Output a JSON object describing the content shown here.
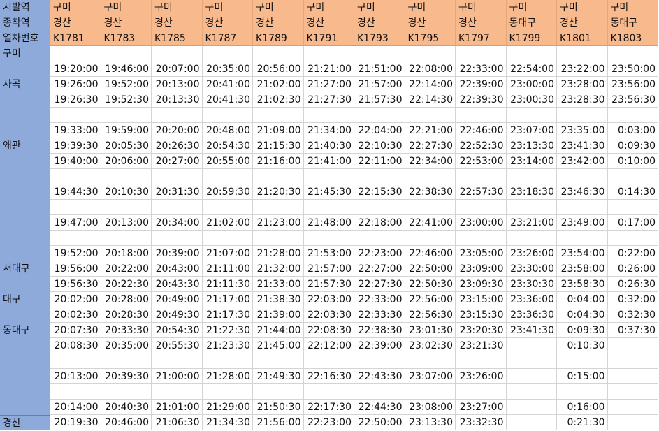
{
  "header": {
    "row_labels": [
      "시발역",
      "종착역",
      "열차번호"
    ],
    "trains": [
      {
        "origin": "구미",
        "dest": "경산",
        "no": "K1781"
      },
      {
        "origin": "구미",
        "dest": "경산",
        "no": "K1783"
      },
      {
        "origin": "구미",
        "dest": "경산",
        "no": "K1785"
      },
      {
        "origin": "구미",
        "dest": "경산",
        "no": "K1787"
      },
      {
        "origin": "구미",
        "dest": "경산",
        "no": "K1789"
      },
      {
        "origin": "구미",
        "dest": "경산",
        "no": "K1791"
      },
      {
        "origin": "구미",
        "dest": "경산",
        "no": "K1793"
      },
      {
        "origin": "구미",
        "dest": "경산",
        "no": "K1795"
      },
      {
        "origin": "구미",
        "dest": "경산",
        "no": "K1797"
      },
      {
        "origin": "구미",
        "dest": "동대구",
        "no": "K1799"
      },
      {
        "origin": "구미",
        "dest": "경산",
        "no": "K1801"
      },
      {
        "origin": "구미",
        "dest": "동대구",
        "no": "K1803"
      }
    ]
  },
  "rows": [
    {
      "label": "구미",
      "times": [
        "",
        "",
        "",
        "",
        "",
        "",
        "",
        "",
        "",
        "",
        "",
        ""
      ]
    },
    {
      "label": "",
      "times": [
        "19:20:00",
        "19:46:00",
        "20:07:00",
        "20:35:00",
        "20:56:00",
        "21:21:00",
        "21:51:00",
        "22:08:00",
        "22:33:00",
        "22:54:00",
        "23:22:00",
        "23:50:00"
      ]
    },
    {
      "label": "사곡",
      "times": [
        "19:26:00",
        "19:52:00",
        "20:13:00",
        "20:41:00",
        "21:02:00",
        "21:27:00",
        "21:57:00",
        "22:14:00",
        "22:39:00",
        "23:00:00",
        "23:28:00",
        "23:56:00"
      ]
    },
    {
      "label": "",
      "times": [
        "19:26:30",
        "19:52:30",
        "20:13:30",
        "20:41:30",
        "21:02:30",
        "21:27:30",
        "21:57:30",
        "22:14:30",
        "22:39:30",
        "23:00:30",
        "23:28:30",
        "23:56:30"
      ]
    },
    {
      "label": "",
      "times": [
        "",
        "",
        "",
        "",
        "",
        "",
        "",
        "",
        "",
        "",
        "",
        ""
      ]
    },
    {
      "label": "",
      "times": [
        "19:33:00",
        "19:59:00",
        "20:20:00",
        "20:48:00",
        "21:09:00",
        "21:34:00",
        "22:04:00",
        "22:21:00",
        "22:46:00",
        "23:07:00",
        "23:35:00",
        "0:03:00"
      ]
    },
    {
      "label": "왜관",
      "times": [
        "19:39:30",
        "20:05:30",
        "20:26:30",
        "20:54:30",
        "21:15:30",
        "21:40:30",
        "22:10:30",
        "22:27:30",
        "22:52:30",
        "23:13:30",
        "23:41:30",
        "0:09:30"
      ]
    },
    {
      "label": "",
      "times": [
        "19:40:00",
        "20:06:00",
        "20:27:00",
        "20:55:00",
        "21:16:00",
        "21:41:00",
        "22:11:00",
        "22:34:00",
        "22:53:00",
        "23:14:00",
        "23:42:00",
        "0:10:00"
      ]
    },
    {
      "label": "",
      "times": [
        "",
        "",
        "",
        "",
        "",
        "",
        "",
        "",
        "",
        "",
        "",
        ""
      ]
    },
    {
      "label": "",
      "times": [
        "19:44:30",
        "20:10:30",
        "20:31:30",
        "20:59:30",
        "21:20:30",
        "21:45:30",
        "22:15:30",
        "22:38:30",
        "22:57:30",
        "23:18:30",
        "23:46:30",
        "0:14:30"
      ]
    },
    {
      "label": "",
      "times": [
        "",
        "",
        "",
        "",
        "",
        "",
        "",
        "",
        "",
        "",
        "",
        ""
      ]
    },
    {
      "label": "",
      "times": [
        "19:47:00",
        "20:13:00",
        "20:34:00",
        "21:02:00",
        "21:23:00",
        "21:48:00",
        "22:18:00",
        "22:41:00",
        "23:00:00",
        "23:21:00",
        "23:49:00",
        "0:17:00"
      ]
    },
    {
      "label": "",
      "times": [
        "",
        "",
        "",
        "",
        "",
        "",
        "",
        "",
        "",
        "",
        "",
        ""
      ]
    },
    {
      "label": "",
      "times": [
        "19:52:00",
        "20:18:00",
        "20:39:00",
        "21:07:00",
        "21:28:00",
        "21:53:00",
        "22:23:00",
        "22:46:00",
        "23:05:00",
        "23:26:00",
        "23:54:00",
        "0:22:00"
      ]
    },
    {
      "label": "서대구",
      "times": [
        "19:56:00",
        "20:22:00",
        "20:43:00",
        "21:11:00",
        "21:32:00",
        "21:57:00",
        "22:27:00",
        "22:50:00",
        "23:09:00",
        "23:30:00",
        "23:58:00",
        "0:26:00"
      ]
    },
    {
      "label": "",
      "times": [
        "19:56:30",
        "20:22:30",
        "20:43:30",
        "21:11:30",
        "21:33:00",
        "21:57:30",
        "22:27:30",
        "22:50:30",
        "23:09:30",
        "23:30:30",
        "23:58:30",
        "0:26:30"
      ]
    },
    {
      "label": "대구",
      "times": [
        "20:02:00",
        "20:28:00",
        "20:49:00",
        "21:17:00",
        "21:38:30",
        "22:03:00",
        "22:33:00",
        "22:56:00",
        "23:15:00",
        "23:36:00",
        "0:04:00",
        "0:32:00"
      ]
    },
    {
      "label": "",
      "times": [
        "20:02:30",
        "20:28:30",
        "20:49:30",
        "21:17:30",
        "21:39:00",
        "22:03:30",
        "22:33:30",
        "22:56:30",
        "23:15:30",
        "23:36:30",
        "0:04:30",
        "0:32:30"
      ]
    },
    {
      "label": "동대구",
      "times": [
        "20:07:30",
        "20:33:30",
        "20:54:30",
        "21:22:30",
        "21:44:00",
        "22:08:30",
        "22:38:30",
        "23:01:30",
        "23:20:30",
        "23:41:30",
        "0:09:30",
        "0:37:30"
      ]
    },
    {
      "label": "",
      "times": [
        "20:08:30",
        "20:35:00",
        "20:55:30",
        "21:23:30",
        "21:45:00",
        "22:12:00",
        "22:39:00",
        "23:02:30",
        "23:21:30",
        "",
        "0:10:30",
        ""
      ]
    },
    {
      "label": "",
      "times": [
        "",
        "",
        "",
        "",
        "",
        "",
        "",
        "",
        "",
        "",
        "",
        ""
      ]
    },
    {
      "label": "",
      "times": [
        "20:13:00",
        "20:39:30",
        "21:00:00",
        "21:28:00",
        "21:49:30",
        "22:16:30",
        "22:43:30",
        "23:07:00",
        "23:26:00",
        "",
        "0:15:00",
        ""
      ]
    },
    {
      "label": "",
      "times": [
        "",
        "",
        "",
        "",
        "",
        "",
        "",
        "",
        "",
        "",
        "",
        ""
      ]
    },
    {
      "label": "",
      "times": [
        "20:14:00",
        "20:40:30",
        "21:01:00",
        "21:29:00",
        "21:50:30",
        "22:17:30",
        "22:44:30",
        "23:08:00",
        "23:27:00",
        "",
        "0:16:00",
        ""
      ]
    },
    {
      "label": "경산",
      "times": [
        "20:19:30",
        "20:46:00",
        "21:06:30",
        "21:34:30",
        "21:56:00",
        "22:23:00",
        "22:50:00",
        "23:13:30",
        "23:32:30",
        "",
        "0:21:30",
        ""
      ]
    }
  ]
}
